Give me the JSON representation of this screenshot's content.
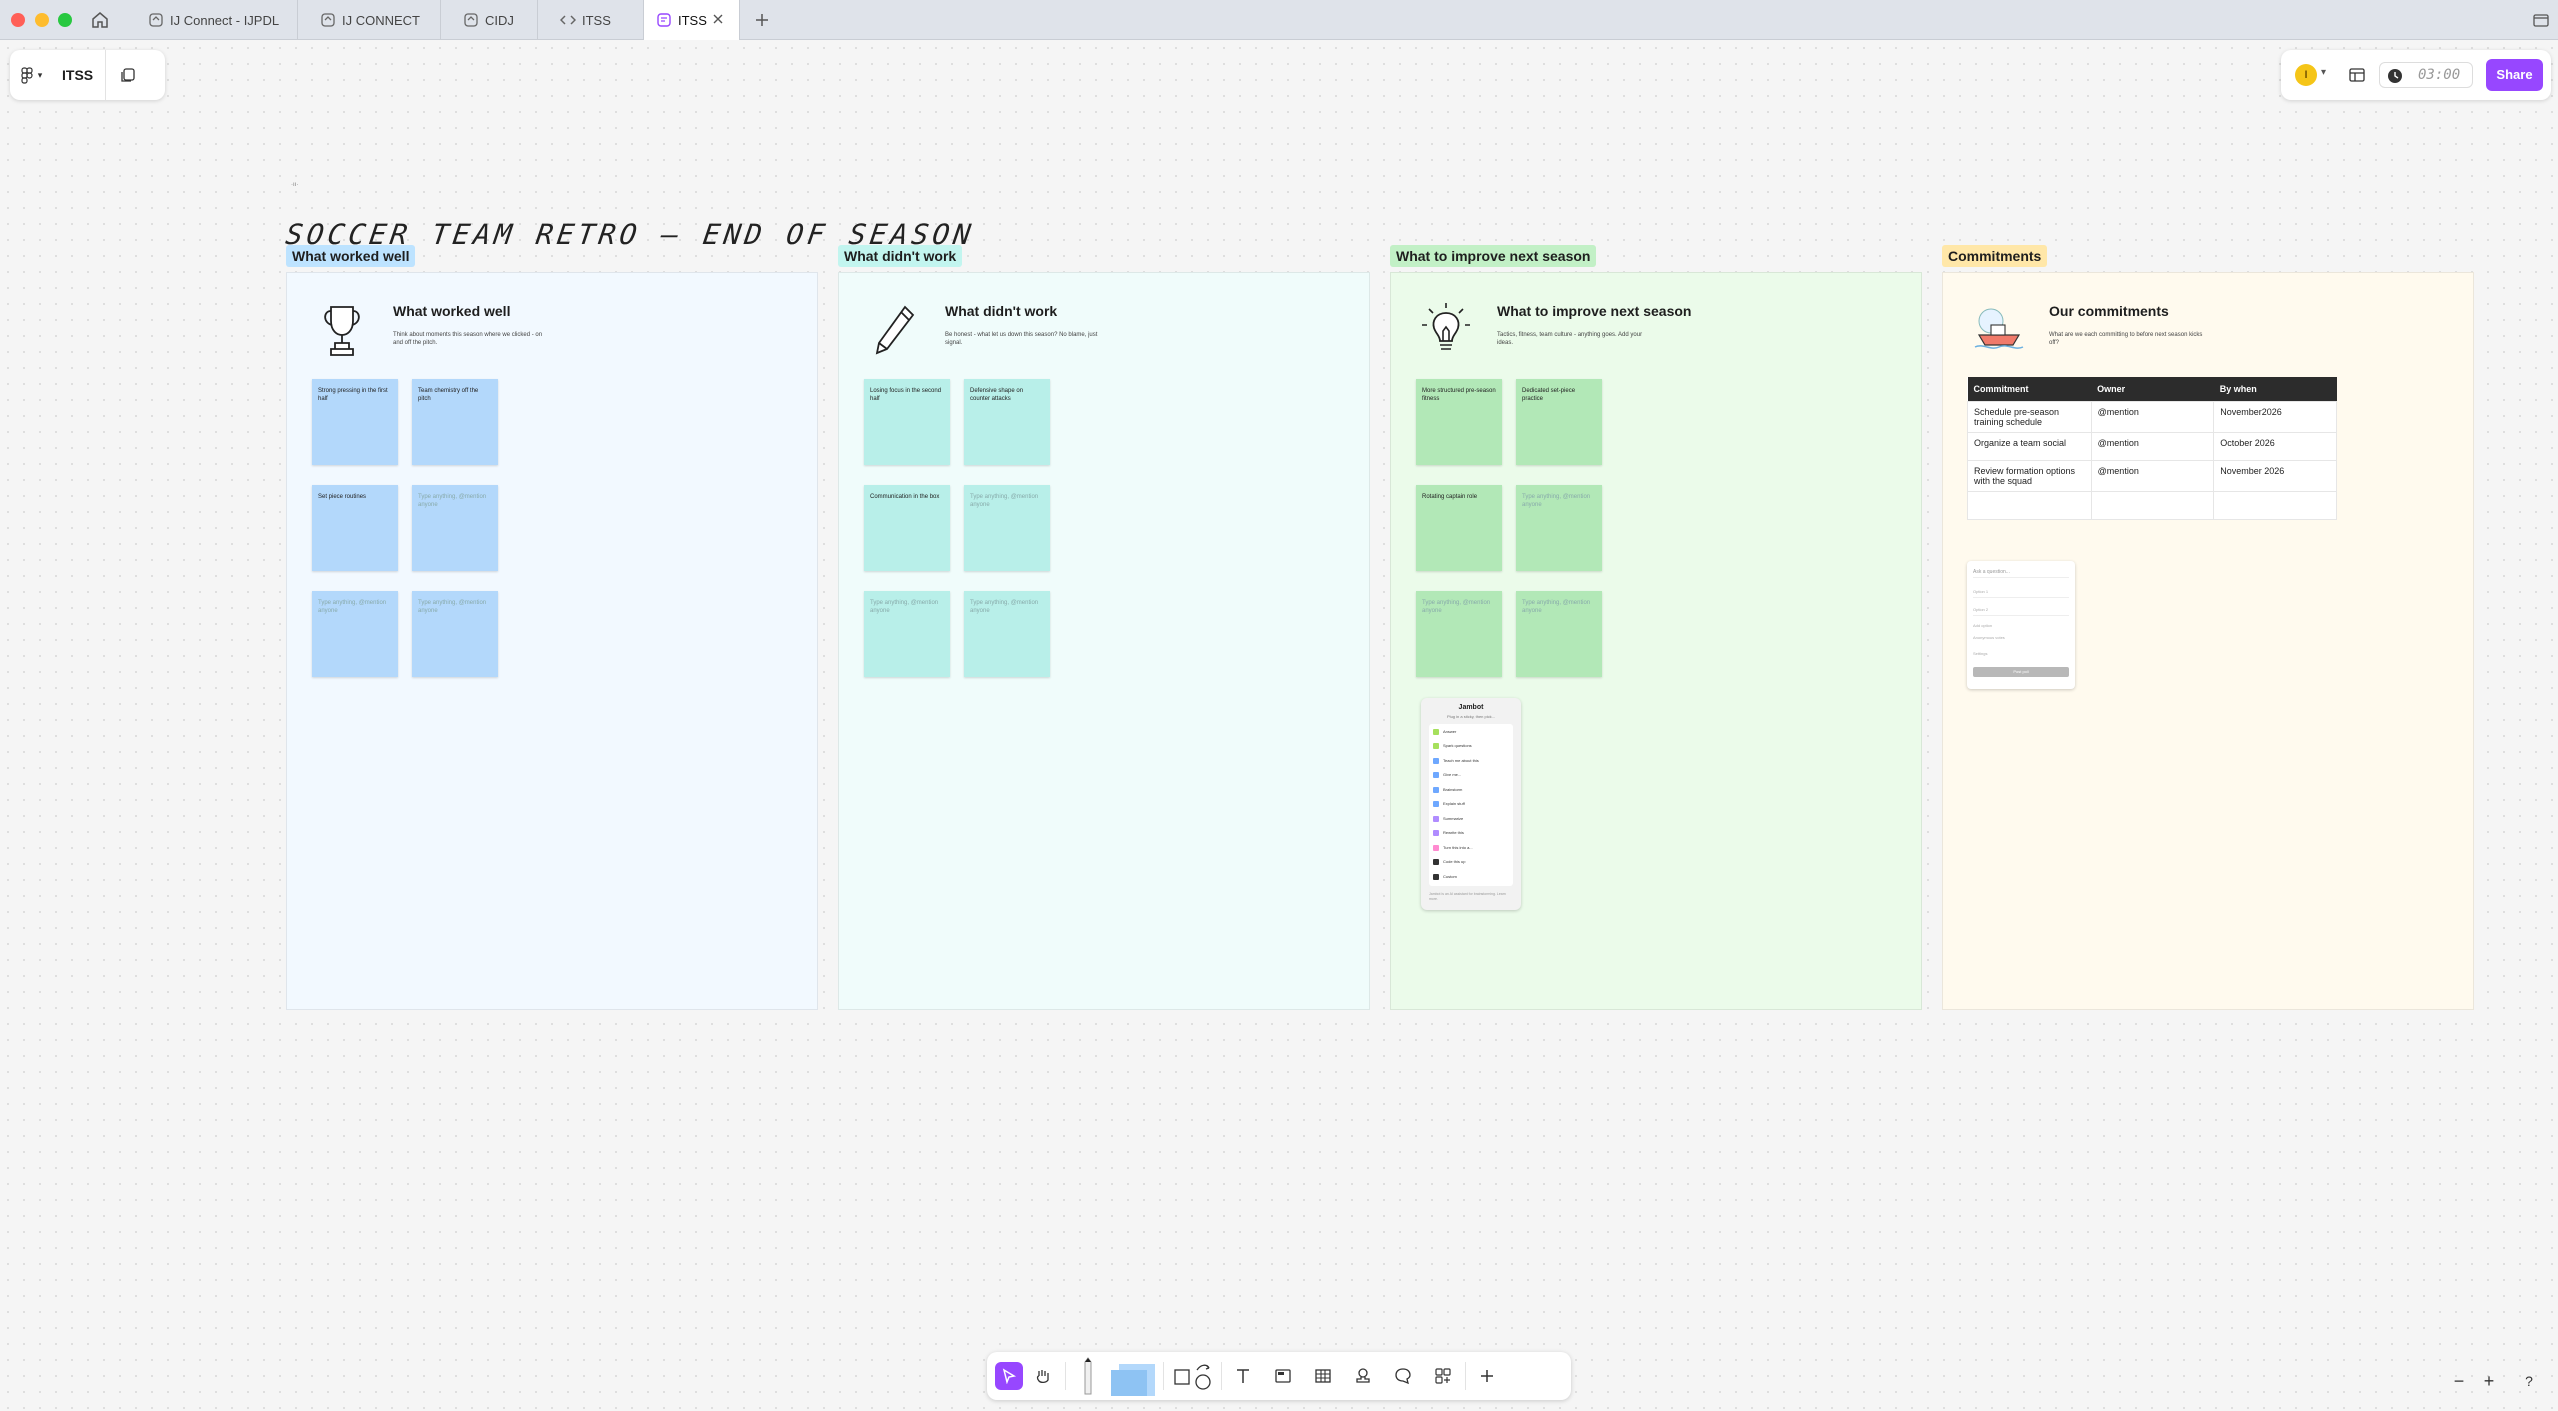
{
  "tabs": [
    {
      "label": "IJ Connect - IJPDL",
      "icon": "figjam-icon"
    },
    {
      "label": "IJ CONNECT",
      "icon": "figjam-icon"
    },
    {
      "label": "CIDJ",
      "icon": "figjam-icon"
    },
    {
      "label": "ITSS",
      "icon": "code-icon"
    },
    {
      "label": "ITSS",
      "icon": "figjam-board-icon",
      "active": true
    }
  ],
  "file": {
    "name": "ITSS"
  },
  "header": {
    "avatar_initial": "I",
    "timer": "03:00",
    "share_label": "Share"
  },
  "board": {
    "title": "SOCCER TEAM RETRO — END OF SEASON"
  },
  "sections": [
    {
      "label": "What worked well",
      "label_color": "#bde3ff",
      "bg": "#f2f9ff",
      "icon": "trophy-icon",
      "heading": "What worked well",
      "description": "Think about moments this season where we clicked - on and off the pitch.",
      "stickies": [
        "Strong pressing in the first half",
        "Team chemistry off the pitch",
        "Set piece routines",
        "Type anything, @mention anyone",
        "Type anything, @mention anyone",
        "Type anything, @mention anyone"
      ]
    },
    {
      "label": "What didn't work",
      "label_color": "#c2f5ef",
      "bg": "#f0fcfb",
      "icon": "pencil-icon",
      "heading": "What didn't work",
      "description": "Be honest - what let us down this season? No blame, just signal.",
      "stickies": [
        "Losing focus in the second half",
        "Defensive shape on counter attacks",
        "Communication in the box",
        "Type anything, @mention anyone",
        "Type anything, @mention anyone",
        "Type anything, @mention anyone"
      ]
    },
    {
      "label": "What to improve next season",
      "label_color": "#c2f0c6",
      "bg": "#ebfbea",
      "icon": "lightbulb-icon",
      "heading": "What to improve next season",
      "description": "Tactics, fitness, team culture - anything goes. Add your ideas.",
      "stickies": [
        "More structured pre-season fitness",
        "Dedicated set-piece practice",
        "Rotating captain role",
        "Type anything, @mention anyone",
        "Type anything, @mention anyone",
        "Type anything, @mention anyone"
      ]
    },
    {
      "label": "Commitments",
      "label_color": "#ffe7a8",
      "bg": "#fffaee",
      "icon": "boat-illustration-icon",
      "heading": "Our commitments",
      "description": "What are we each committing to before next season kicks off?"
    }
  ],
  "commitments_table": {
    "headers": [
      "Commitment",
      "Owner",
      "By when"
    ],
    "rows": [
      [
        "Schedule pre-season training schedule",
        "@mention",
        "November2026"
      ],
      [
        "Organize a team social",
        "@mention",
        "October 2026"
      ],
      [
        "Review formation options with the squad",
        "@mention",
        "November 2026"
      ],
      [
        "",
        "",
        ""
      ]
    ]
  },
  "form": {
    "title": "Ask a question...",
    "fields": [
      "Option 1",
      "Option 2",
      "Add option",
      "Anonymous votes",
      "Settings"
    ],
    "button": "Post poll"
  },
  "jambot": {
    "title": "Jambot",
    "subtitle": "Plug in a sticky, then pick...",
    "items": [
      {
        "label": "Answer",
        "color": "#a6e05c"
      },
      {
        "label": "Spark questions",
        "color": "#a6e05c"
      },
      {
        "label": "Teach me about this",
        "color": "#6ea8ff"
      },
      {
        "label": "Give me...",
        "color": "#6ea8ff"
      },
      {
        "label": "Brainstorm",
        "color": "#6ea8ff"
      },
      {
        "label": "Explain stuff",
        "color": "#6ea8ff"
      },
      {
        "label": "Summarize",
        "color": "#b08cff"
      },
      {
        "label": "Rewrite this",
        "color": "#b08cff"
      },
      {
        "label": "Turn this into a...",
        "color": "#ff8ad0"
      },
      {
        "label": "Code this up",
        "color": "#333333"
      },
      {
        "label": "Custom",
        "color": "#333333"
      }
    ],
    "footer": "Jambot is an AI assistant for brainstorming. Learn more."
  },
  "toolbar": {
    "tools": [
      "move-tool",
      "hand-tool",
      "marker-tool",
      "sticky-tool",
      "shape-tool",
      "connector-tool",
      "text-tool",
      "section-tool",
      "table-tool",
      "stamp-tool",
      "comment-tool",
      "more-tools",
      "add-tool"
    ]
  },
  "colors": {
    "accent": "#9747ff"
  }
}
